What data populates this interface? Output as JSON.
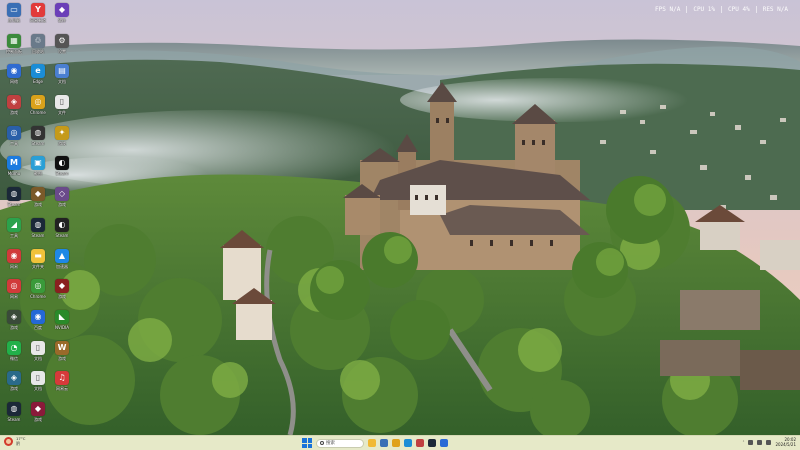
{
  "perf_overlay": [
    "FPS N/A",
    "CPU 1%",
    "CPU 4%",
    "RES N/A"
  ],
  "desktop_icons": [
    {
      "label": "此电脑",
      "icon": "computer-icon",
      "color": "#3a6fb5",
      "glyph": "▭"
    },
    {
      "label": "网易有道",
      "icon": "youdao-icon",
      "color": "#e23a3a",
      "glyph": "Y"
    },
    {
      "label": "软件",
      "icon": "app-icon",
      "color": "#6b3fb8",
      "glyph": "◆"
    },
    {
      "label": "控制面板",
      "icon": "control-panel-icon",
      "color": "#3b8a3b",
      "glyph": "▦"
    },
    {
      "label": "回收站",
      "icon": "recycle-bin-icon",
      "color": "#6a7a8a",
      "glyph": "♲"
    },
    {
      "label": "设置",
      "icon": "settings-icon",
      "color": "#555555",
      "glyph": "⚙"
    },
    {
      "label": "网络",
      "icon": "network-icon",
      "color": "#2f6bd1",
      "glyph": "◉"
    },
    {
      "label": "Edge",
      "icon": "edge-icon",
      "color": "#1b8dd6",
      "glyph": "e"
    },
    {
      "label": "文档",
      "icon": "document-icon",
      "color": "#4a7fd0",
      "glyph": "▤"
    },
    {
      "label": "游戏",
      "icon": "game-icon",
      "color": "#c04040",
      "glyph": "◈"
    },
    {
      "label": "Chrome",
      "icon": "chrome-icon",
      "color": "#d9a21b",
      "glyph": "◎"
    },
    {
      "label": "文件",
      "icon": "file-icon",
      "color": "#e8e8e8",
      "glyph": "▯"
    },
    {
      "label": "工具",
      "icon": "tool-icon",
      "color": "#2a5fa8",
      "glyph": "◎"
    },
    {
      "label": "Steam",
      "icon": "steam-icon",
      "color": "#333333",
      "glyph": "◍"
    },
    {
      "label": "游戏",
      "icon": "game-icon",
      "color": "#c59a1a",
      "glyph": "✦"
    },
    {
      "label": "Mumu",
      "icon": "mumu-icon",
      "color": "#1b7be0",
      "glyph": "M"
    },
    {
      "label": "截图",
      "icon": "screenshot-icon",
      "color": "#2a9fd6",
      "glyph": "▣"
    },
    {
      "label": "Steam",
      "icon": "steam-icon",
      "color": "#111111",
      "glyph": "◐"
    },
    {
      "label": "Steam",
      "icon": "steam-icon",
      "color": "#1b2838",
      "glyph": "◍"
    },
    {
      "label": "游戏",
      "icon": "game-icon",
      "color": "#7a5a2a",
      "glyph": "◆"
    },
    {
      "label": "游戏",
      "icon": "game-icon",
      "color": "#6a4a8a",
      "glyph": "◇"
    },
    {
      "label": "工具",
      "icon": "tool-icon",
      "color": "#2ba24c",
      "glyph": "◢"
    },
    {
      "label": "Steam",
      "icon": "steam-icon",
      "color": "#1b2838",
      "glyph": "◍"
    },
    {
      "label": "Steam",
      "icon": "steam-icon",
      "color": "#222222",
      "glyph": "◐"
    },
    {
      "label": "网易",
      "icon": "netease-icon",
      "color": "#d13a3a",
      "glyph": "◉"
    },
    {
      "label": "文件夹",
      "icon": "folder-icon",
      "color": "#f0c23a",
      "glyph": "▬"
    },
    {
      "label": "加速器",
      "icon": "accelerator-icon",
      "color": "#1e88e5",
      "glyph": "▲"
    },
    {
      "label": "网易",
      "icon": "netease-icon",
      "color": "#d13a3a",
      "glyph": "◎"
    },
    {
      "label": "Chrome",
      "icon": "chrome-icon",
      "color": "#3a9a3a",
      "glyph": "◎"
    },
    {
      "label": "游戏",
      "icon": "game-icon",
      "color": "#8a2020",
      "glyph": "◆"
    },
    {
      "label": "游戏",
      "icon": "game-icon",
      "color": "#3a4a3a",
      "glyph": "◈"
    },
    {
      "label": "百度",
      "icon": "baidu-icon",
      "color": "#2468d6",
      "glyph": "◉"
    },
    {
      "label": "NVIDIA",
      "icon": "nvidia-icon",
      "color": "#2a8a2a",
      "glyph": "◣"
    },
    {
      "label": "微信",
      "icon": "wechat-icon",
      "color": "#22b04a",
      "glyph": "◔"
    },
    {
      "label": "文档",
      "icon": "document-icon",
      "color": "#e8e8e8",
      "glyph": "▯"
    },
    {
      "label": "游戏",
      "icon": "game-icon",
      "color": "#9a6a2a",
      "glyph": "W"
    },
    {
      "label": "游戏",
      "icon": "game-icon",
      "color": "#2a6a8a",
      "glyph": "◈"
    },
    {
      "label": "文档",
      "icon": "document-icon",
      "color": "#e8e8e8",
      "glyph": "▯"
    },
    {
      "label": "网易云",
      "icon": "music-icon",
      "color": "#d63a3a",
      "glyph": "♫"
    },
    {
      "label": "Steam",
      "icon": "steam-icon",
      "color": "#1b2838",
      "glyph": "◍"
    },
    {
      "label": "游戏",
      "icon": "game-icon",
      "color": "#8a1a3a",
      "glyph": "◆"
    }
  ],
  "taskbar": {
    "weather_temp": "17°C",
    "weather_desc": "阴",
    "search_placeholder": "搜索",
    "pinned_apps": [
      {
        "icon": "file-explorer-icon",
        "color": "#f1b933"
      },
      {
        "icon": "folder-icon",
        "color": "#3a6fb5"
      },
      {
        "icon": "chrome-icon",
        "color": "#e0a21b"
      },
      {
        "icon": "edge-icon",
        "color": "#1b8dd6"
      },
      {
        "icon": "game-icon",
        "color": "#c04040"
      },
      {
        "icon": "steam-icon",
        "color": "#1b2838"
      },
      {
        "icon": "app-icon",
        "color": "#2a6ad6"
      }
    ],
    "clock_time": "20:02",
    "clock_date": "2024/5/21"
  }
}
